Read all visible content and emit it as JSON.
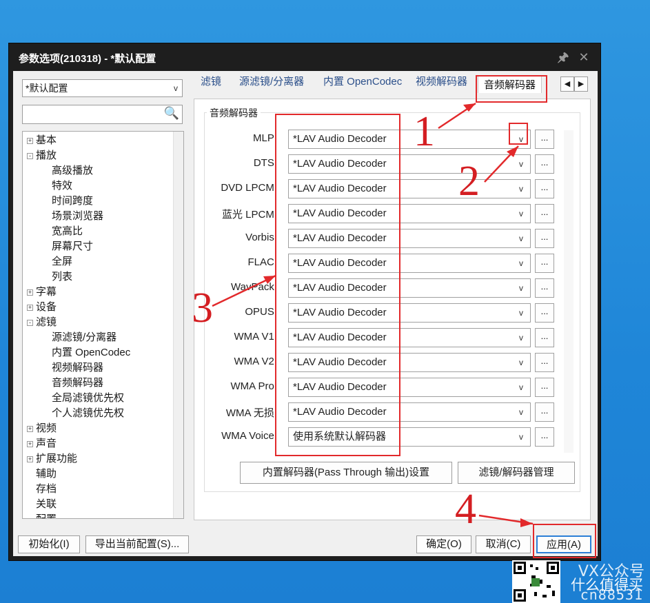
{
  "window": {
    "title": "参数选项(210318) - *默认配置"
  },
  "profile": {
    "selected": "*默认配置"
  },
  "search": {
    "placeholder": ""
  },
  "tree": [
    {
      "label": "基本",
      "level": 0,
      "expander": "+"
    },
    {
      "label": "播放",
      "level": 0,
      "expander": "-"
    },
    {
      "label": "高级播放",
      "level": 1
    },
    {
      "label": "特效",
      "level": 1
    },
    {
      "label": "时间跨度",
      "level": 1
    },
    {
      "label": "场景浏览器",
      "level": 1
    },
    {
      "label": "宽高比",
      "level": 1
    },
    {
      "label": "屏幕尺寸",
      "level": 1
    },
    {
      "label": "全屏",
      "level": 1
    },
    {
      "label": "列表",
      "level": 1
    },
    {
      "label": "字幕",
      "level": 0,
      "expander": "+"
    },
    {
      "label": "设备",
      "level": 0,
      "expander": "+"
    },
    {
      "label": "滤镜",
      "level": 0,
      "expander": "-"
    },
    {
      "label": "源滤镜/分离器",
      "level": 1
    },
    {
      "label": "内置 OpenCodec",
      "level": 1
    },
    {
      "label": "视频解码器",
      "level": 1
    },
    {
      "label": "音频解码器",
      "level": 1
    },
    {
      "label": "全局滤镜优先权",
      "level": 1
    },
    {
      "label": "个人滤镜优先权",
      "level": 1
    },
    {
      "label": "视频",
      "level": 0,
      "expander": "+"
    },
    {
      "label": "声音",
      "level": 0,
      "expander": "+"
    },
    {
      "label": "扩展功能",
      "level": 0,
      "expander": "+"
    },
    {
      "label": "辅助",
      "level": 0
    },
    {
      "label": "存档",
      "level": 0
    },
    {
      "label": "关联",
      "level": 0
    },
    {
      "label": "配置",
      "level": 0
    }
  ],
  "tabs": [
    {
      "label": "滤镜"
    },
    {
      "label": "源滤镜/分离器"
    },
    {
      "label": "内置 OpenCodec"
    },
    {
      "label": "视频解码器"
    },
    {
      "label": "音频解码器",
      "active": true
    }
  ],
  "panel": {
    "group_title": "音频解码器",
    "rows": [
      {
        "label": "MLP:",
        "value": "*LAV Audio Decoder"
      },
      {
        "label": "DTS:",
        "value": "*LAV Audio Decoder"
      },
      {
        "label": "DVD LPCM:",
        "value": "*LAV Audio Decoder"
      },
      {
        "label": "蓝光 LPCM:",
        "value": "*LAV Audio Decoder"
      },
      {
        "label": "Vorbis:",
        "value": "*LAV Audio Decoder"
      },
      {
        "label": "FLAC:",
        "value": "*LAV Audio Decoder"
      },
      {
        "label": "WavPack:",
        "value": "*LAV Audio Decoder"
      },
      {
        "label": "OPUS:",
        "value": "*LAV Audio Decoder"
      },
      {
        "label": "WMA V1:",
        "value": "*LAV Audio Decoder"
      },
      {
        "label": "WMA V2:",
        "value": "*LAV Audio Decoder"
      },
      {
        "label": "WMA Pro:",
        "value": "*LAV Audio Decoder"
      },
      {
        "label": "WMA 无损:",
        "value": "*LAV Audio Decoder"
      },
      {
        "label": "WMA Voice:",
        "value": "使用系统默认解码器"
      }
    ],
    "dots_label": "...",
    "passthrough_button": "内置解码器(Pass Through 输出)设置",
    "filter_manager_button": "滤镜/解码器管理"
  },
  "footer": {
    "init_button": "初始化(I)",
    "export_button": "导出当前配置(S)...",
    "ok_button": "确定(O)",
    "cancel_button": "取消(C)",
    "apply_button": "应用(A)"
  },
  "annotations": {
    "numbers": [
      "1",
      "2",
      "3",
      "4"
    ],
    "color": "#e2292b"
  },
  "watermark": {
    "line1": "VX公众号",
    "line2": "什么值得买",
    "line3": "cn88531"
  }
}
